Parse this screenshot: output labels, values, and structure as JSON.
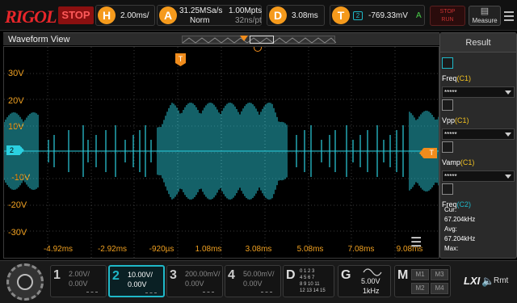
{
  "brand": {
    "name_main": "RIGOL"
  },
  "status": {
    "run_state": "STOP"
  },
  "horizontal": {
    "letter": "H",
    "timebase": "2.00ms/"
  },
  "acquire": {
    "letter": "A",
    "sample_rate": "31.25MSa/s",
    "memory_depth": "1.00Mpts",
    "mode": "Norm",
    "time_per_point": "32ns/pt"
  },
  "delay": {
    "letter": "D",
    "offset": "3.08ms"
  },
  "trigger": {
    "letter": "T",
    "source": "2",
    "level": "-769.33mV",
    "coupling": "A"
  },
  "buttons": {
    "run_stop_line1": "STOP",
    "run_stop_line2": "RUN",
    "measure": "Measure"
  },
  "waveform_view": {
    "title": "Waveform View",
    "y_labels": [
      "30V",
      "20V",
      "10V",
      "0V",
      "-10V",
      "-20V",
      "-30V"
    ],
    "x_labels": [
      "-4.92ms",
      "-2.92ms",
      "-920µs",
      "1.08ms",
      "3.08ms",
      "5.08ms",
      "7.08ms",
      "9.08ms"
    ],
    "channel_marker": "2",
    "trigger_marker": "T",
    "time_marker": "T",
    "trace_color": "#2bd0e0"
  },
  "result_panel": {
    "title": "Result",
    "items": [
      {
        "name": "Freq",
        "source": "(C1)",
        "value": "*****"
      },
      {
        "name": "Vpp",
        "source": "(C1)",
        "value": "*****"
      },
      {
        "name": "Vamp",
        "source": "(C1)",
        "value": "*****"
      },
      {
        "name": "Freq",
        "source": "(C2)"
      }
    ],
    "stats": {
      "cur_label": "Cur:",
      "cur_value": "67.204kHz",
      "avg_label": "Avg:",
      "avg_value": "67.204kHz",
      "max_label": "Max:"
    }
  },
  "channels": [
    {
      "num": "1",
      "scale": "2.00V/",
      "offset": "0.00V"
    },
    {
      "num": "2",
      "scale": "10.00V/",
      "offset": "0.00V"
    },
    {
      "num": "3",
      "scale": "200.00mV/",
      "offset": "0.00V"
    },
    {
      "num": "4",
      "scale": "50.00mV/",
      "offset": "0.00V"
    }
  ],
  "digital": {
    "letter": "D",
    "rows": [
      "0 1 2 3",
      "4 5 6 7",
      "8 9 10 11",
      "12 13 14 15"
    ]
  },
  "generator": {
    "letter": "G",
    "amplitude": "5.00V",
    "frequency": "1kHz"
  },
  "math": {
    "letter": "M",
    "buttons": [
      "M1",
      "M3",
      "M2",
      "M4"
    ]
  },
  "status_icons": {
    "lxi": "LXI",
    "remote": "Rmt"
  },
  "colors": {
    "accent_cyan": "#1fb8c8",
    "trace": "#2bd0e0",
    "orange": "#f08c1c",
    "stop_red": "#e8262a"
  }
}
